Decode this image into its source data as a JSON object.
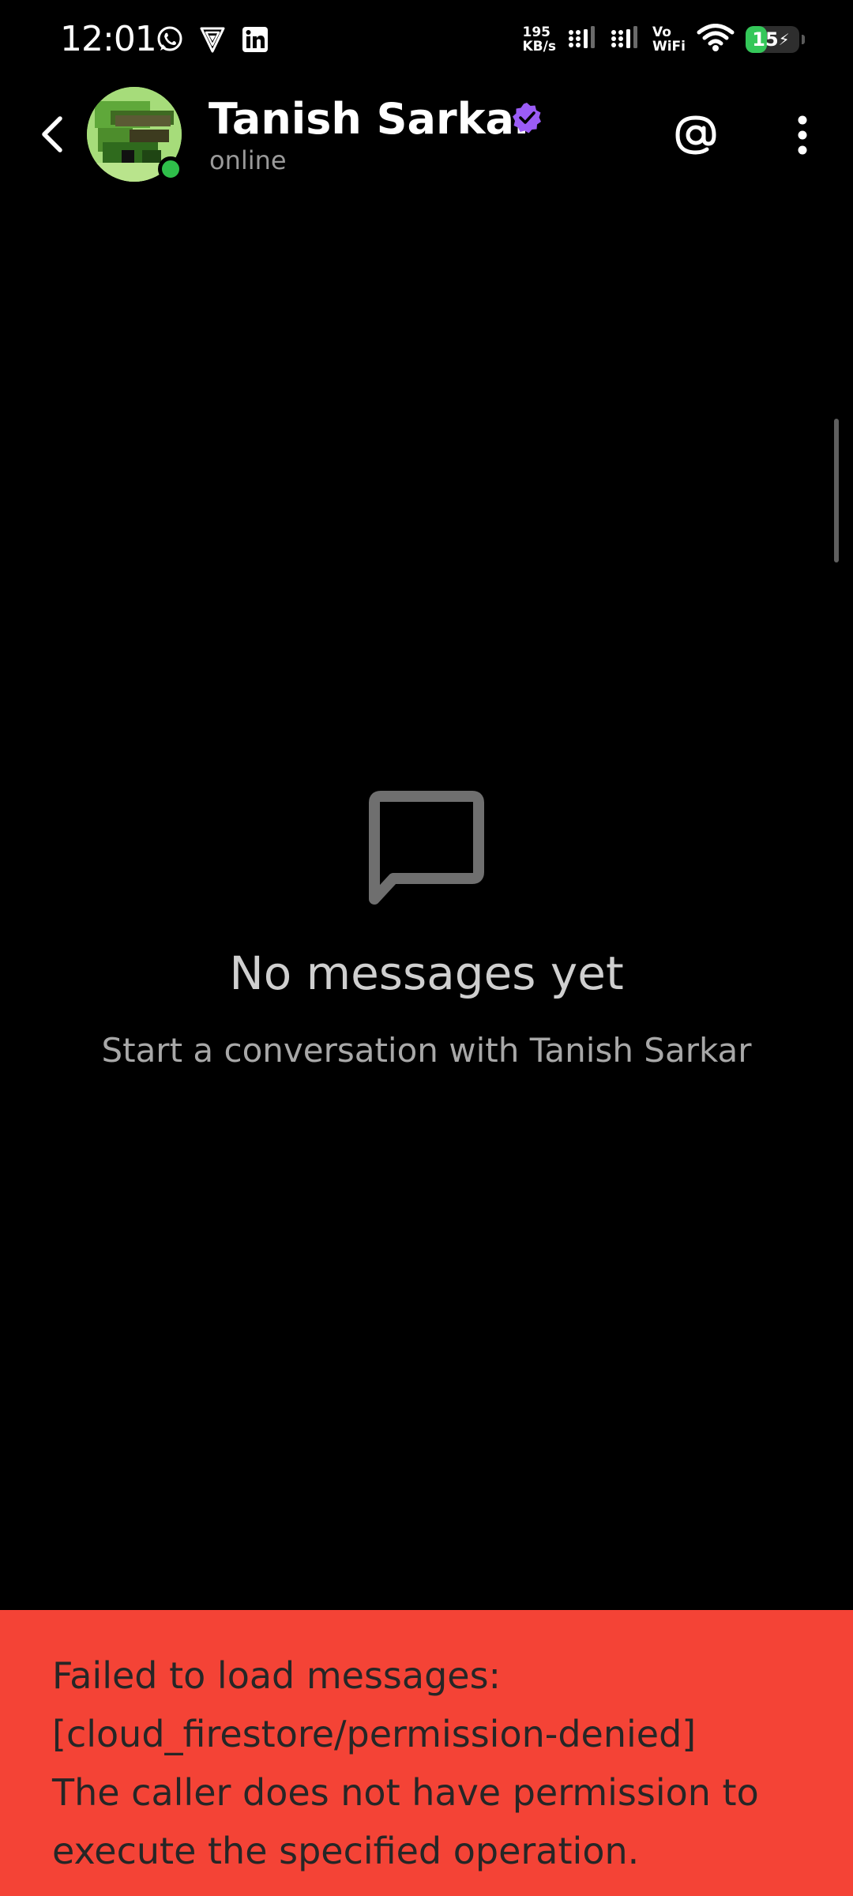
{
  "status_bar": {
    "time": "12:01",
    "net_speed_value": "195",
    "net_speed_unit": "KB/s",
    "vowifi_top": "Vo",
    "vowifi_bottom": "WiFi",
    "battery_level": "15",
    "battery_percent": 15,
    "notification_icons": [
      "whatsapp-icon",
      "vpn-shield-icon",
      "linkedin-icon"
    ]
  },
  "header": {
    "contact_name": "Tanish Sarkar",
    "status": "online",
    "verified": true,
    "colors": {
      "verified_badge": "#9b5cf6",
      "online_dot": "#2fbf4a"
    }
  },
  "empty_state": {
    "title": "No messages yet",
    "subtitle": "Start a conversation with Tanish Sarkar"
  },
  "error_banner": {
    "message": "Failed to load messages:\n[cloud_firestore/permission-denied]\nThe caller does not have permission to\nexecute the specified operation.",
    "color": "#f44336"
  }
}
